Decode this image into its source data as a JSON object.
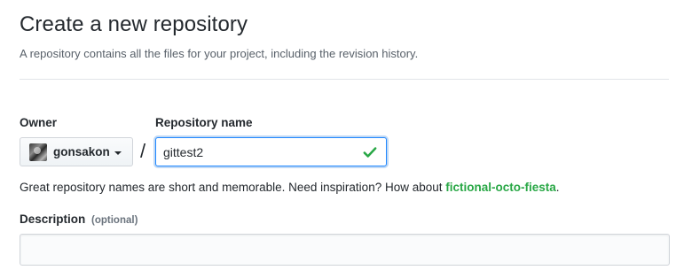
{
  "header": {
    "title": "Create a new repository",
    "subtitle": "A repository contains all the files for your project, including the revision history."
  },
  "owner": {
    "label": "Owner",
    "selected": "gonsakon"
  },
  "separator": "/",
  "repository": {
    "label": "Repository name",
    "value": "gittest2",
    "valid": true
  },
  "help": {
    "text": "Great repository names are short and memorable. Need inspiration? How about ",
    "suggestion": "fictional-octo-fiesta",
    "suffix": "."
  },
  "description": {
    "label": "Description",
    "optional_tag": "(optional)",
    "value": "",
    "placeholder": ""
  },
  "colors": {
    "accent_green": "#28a745",
    "focus_blue": "#2188ff",
    "text": "#24292e",
    "muted": "#586069"
  },
  "icons": {
    "owner_avatar": "user-avatar",
    "owner_caret": "caret-down-icon",
    "repo_valid": "check-icon"
  }
}
